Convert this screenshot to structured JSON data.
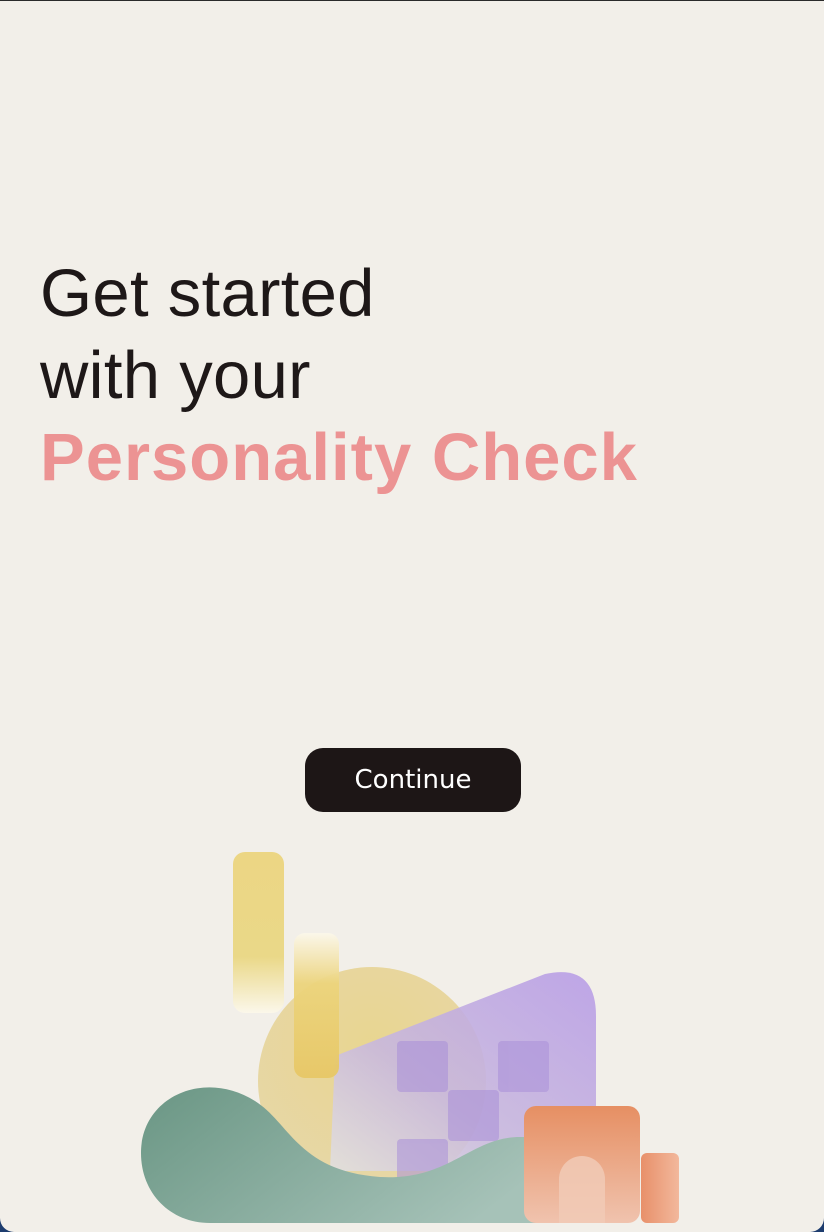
{
  "headline": {
    "line1": "Get started",
    "line2": "with your",
    "accent": "Personality Check"
  },
  "actions": {
    "continue_label": "Continue"
  },
  "colors": {
    "background": "#f2efe9",
    "text": "#1e1818",
    "accent": "#ec9393",
    "button": "#1d1616"
  },
  "illustration": {
    "icon": "abstract-shapes-illustration"
  }
}
